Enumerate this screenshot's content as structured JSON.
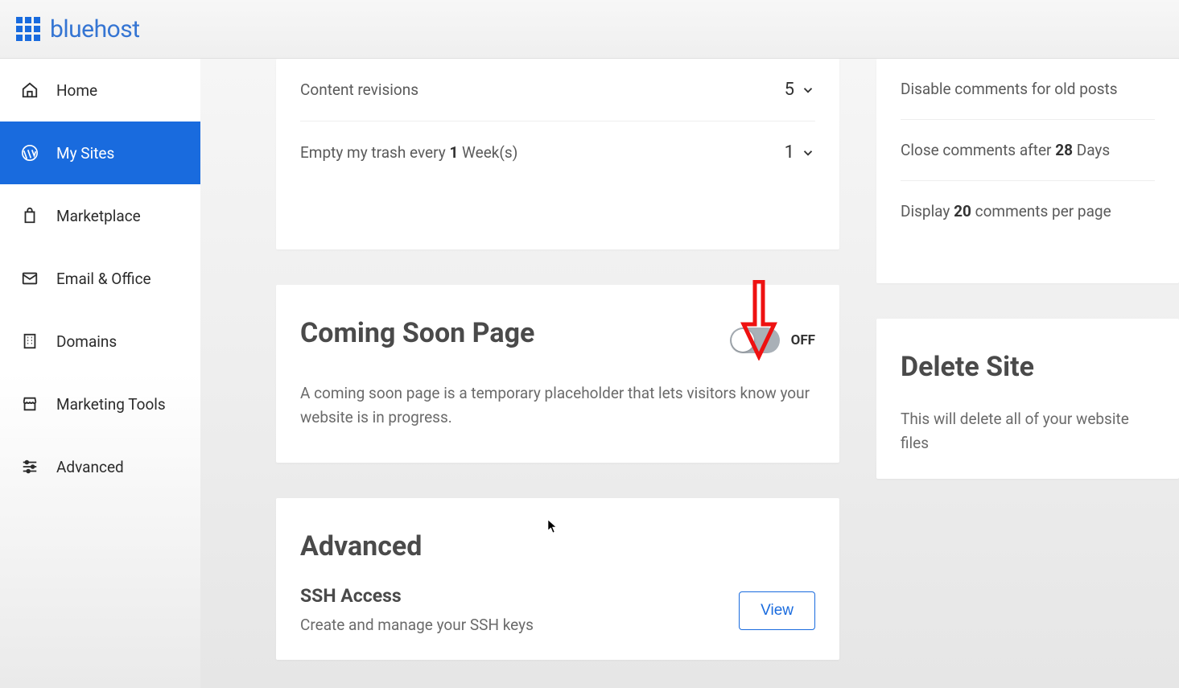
{
  "brand": "bluehost",
  "sidebar": {
    "items": [
      {
        "label": "Home",
        "icon": "home-icon"
      },
      {
        "label": "My Sites",
        "icon": "wordpress-icon"
      },
      {
        "label": "Marketplace",
        "icon": "bag-icon"
      },
      {
        "label": "Email & Office",
        "icon": "mail-icon"
      },
      {
        "label": "Domains",
        "icon": "building-icon"
      },
      {
        "label": "Marketing Tools",
        "icon": "store-icon"
      },
      {
        "label": "Advanced",
        "icon": "sliders-icon"
      }
    ],
    "activeIndex": 1
  },
  "settings_card": {
    "revisions_label": "Content revisions",
    "revisions_value": "5",
    "trash_label_pre": "Empty my trash every ",
    "trash_value_inline": "1",
    "trash_label_post": " Week(s)",
    "trash_select": "1"
  },
  "coming_soon": {
    "title": "Coming Soon Page",
    "toggle_state": "OFF",
    "desc": "A coming soon page is a temporary placeholder that lets visitors know your website is in progress."
  },
  "advanced": {
    "title": "Advanced",
    "ssh_title": "SSH Access",
    "ssh_desc": "Create and manage your SSH keys",
    "view_btn": "View"
  },
  "comments_card": {
    "disable_label": "Disable comments for old posts",
    "close_pre": "Close comments after ",
    "close_value": "28",
    "close_post": " Days",
    "display_pre": "Display ",
    "display_value": "20",
    "display_post": " comments per page"
  },
  "delete_card": {
    "title": "Delete Site",
    "desc": "This will delete all of your website files"
  }
}
